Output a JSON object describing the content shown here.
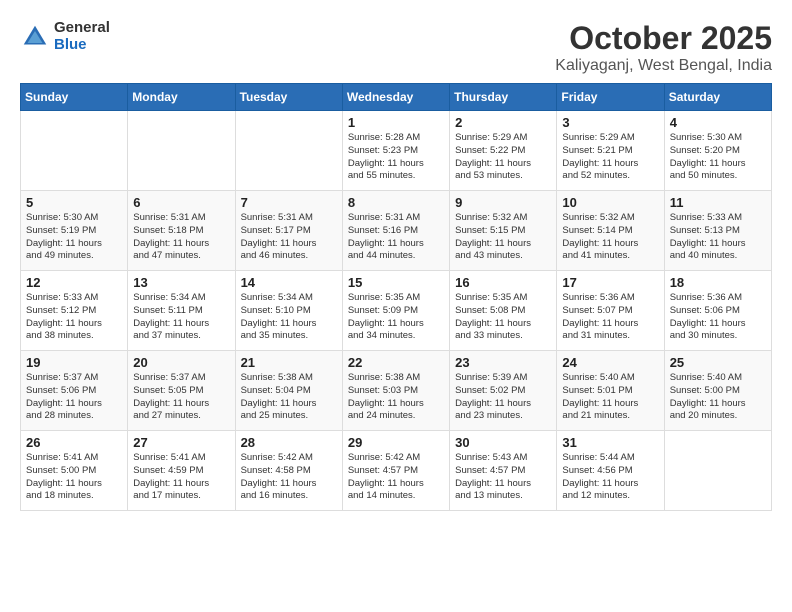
{
  "logo": {
    "general": "General",
    "blue": "Blue"
  },
  "title": "October 2025",
  "subtitle": "Kaliyaganj, West Bengal, India",
  "days_of_week": [
    "Sunday",
    "Monday",
    "Tuesday",
    "Wednesday",
    "Thursday",
    "Friday",
    "Saturday"
  ],
  "weeks": [
    [
      {
        "day": "",
        "info": ""
      },
      {
        "day": "",
        "info": ""
      },
      {
        "day": "",
        "info": ""
      },
      {
        "day": "1",
        "info": "Sunrise: 5:28 AM\nSunset: 5:23 PM\nDaylight: 11 hours\nand 55 minutes."
      },
      {
        "day": "2",
        "info": "Sunrise: 5:29 AM\nSunset: 5:22 PM\nDaylight: 11 hours\nand 53 minutes."
      },
      {
        "day": "3",
        "info": "Sunrise: 5:29 AM\nSunset: 5:21 PM\nDaylight: 11 hours\nand 52 minutes."
      },
      {
        "day": "4",
        "info": "Sunrise: 5:30 AM\nSunset: 5:20 PM\nDaylight: 11 hours\nand 50 minutes."
      }
    ],
    [
      {
        "day": "5",
        "info": "Sunrise: 5:30 AM\nSunset: 5:19 PM\nDaylight: 11 hours\nand 49 minutes."
      },
      {
        "day": "6",
        "info": "Sunrise: 5:31 AM\nSunset: 5:18 PM\nDaylight: 11 hours\nand 47 minutes."
      },
      {
        "day": "7",
        "info": "Sunrise: 5:31 AM\nSunset: 5:17 PM\nDaylight: 11 hours\nand 46 minutes."
      },
      {
        "day": "8",
        "info": "Sunrise: 5:31 AM\nSunset: 5:16 PM\nDaylight: 11 hours\nand 44 minutes."
      },
      {
        "day": "9",
        "info": "Sunrise: 5:32 AM\nSunset: 5:15 PM\nDaylight: 11 hours\nand 43 minutes."
      },
      {
        "day": "10",
        "info": "Sunrise: 5:32 AM\nSunset: 5:14 PM\nDaylight: 11 hours\nand 41 minutes."
      },
      {
        "day": "11",
        "info": "Sunrise: 5:33 AM\nSunset: 5:13 PM\nDaylight: 11 hours\nand 40 minutes."
      }
    ],
    [
      {
        "day": "12",
        "info": "Sunrise: 5:33 AM\nSunset: 5:12 PM\nDaylight: 11 hours\nand 38 minutes."
      },
      {
        "day": "13",
        "info": "Sunrise: 5:34 AM\nSunset: 5:11 PM\nDaylight: 11 hours\nand 37 minutes."
      },
      {
        "day": "14",
        "info": "Sunrise: 5:34 AM\nSunset: 5:10 PM\nDaylight: 11 hours\nand 35 minutes."
      },
      {
        "day": "15",
        "info": "Sunrise: 5:35 AM\nSunset: 5:09 PM\nDaylight: 11 hours\nand 34 minutes."
      },
      {
        "day": "16",
        "info": "Sunrise: 5:35 AM\nSunset: 5:08 PM\nDaylight: 11 hours\nand 33 minutes."
      },
      {
        "day": "17",
        "info": "Sunrise: 5:36 AM\nSunset: 5:07 PM\nDaylight: 11 hours\nand 31 minutes."
      },
      {
        "day": "18",
        "info": "Sunrise: 5:36 AM\nSunset: 5:06 PM\nDaylight: 11 hours\nand 30 minutes."
      }
    ],
    [
      {
        "day": "19",
        "info": "Sunrise: 5:37 AM\nSunset: 5:06 PM\nDaylight: 11 hours\nand 28 minutes."
      },
      {
        "day": "20",
        "info": "Sunrise: 5:37 AM\nSunset: 5:05 PM\nDaylight: 11 hours\nand 27 minutes."
      },
      {
        "day": "21",
        "info": "Sunrise: 5:38 AM\nSunset: 5:04 PM\nDaylight: 11 hours\nand 25 minutes."
      },
      {
        "day": "22",
        "info": "Sunrise: 5:38 AM\nSunset: 5:03 PM\nDaylight: 11 hours\nand 24 minutes."
      },
      {
        "day": "23",
        "info": "Sunrise: 5:39 AM\nSunset: 5:02 PM\nDaylight: 11 hours\nand 23 minutes."
      },
      {
        "day": "24",
        "info": "Sunrise: 5:40 AM\nSunset: 5:01 PM\nDaylight: 11 hours\nand 21 minutes."
      },
      {
        "day": "25",
        "info": "Sunrise: 5:40 AM\nSunset: 5:00 PM\nDaylight: 11 hours\nand 20 minutes."
      }
    ],
    [
      {
        "day": "26",
        "info": "Sunrise: 5:41 AM\nSunset: 5:00 PM\nDaylight: 11 hours\nand 18 minutes."
      },
      {
        "day": "27",
        "info": "Sunrise: 5:41 AM\nSunset: 4:59 PM\nDaylight: 11 hours\nand 17 minutes."
      },
      {
        "day": "28",
        "info": "Sunrise: 5:42 AM\nSunset: 4:58 PM\nDaylight: 11 hours\nand 16 minutes."
      },
      {
        "day": "29",
        "info": "Sunrise: 5:42 AM\nSunset: 4:57 PM\nDaylight: 11 hours\nand 14 minutes."
      },
      {
        "day": "30",
        "info": "Sunrise: 5:43 AM\nSunset: 4:57 PM\nDaylight: 11 hours\nand 13 minutes."
      },
      {
        "day": "31",
        "info": "Sunrise: 5:44 AM\nSunset: 4:56 PM\nDaylight: 11 hours\nand 12 minutes."
      },
      {
        "day": "",
        "info": ""
      }
    ]
  ]
}
